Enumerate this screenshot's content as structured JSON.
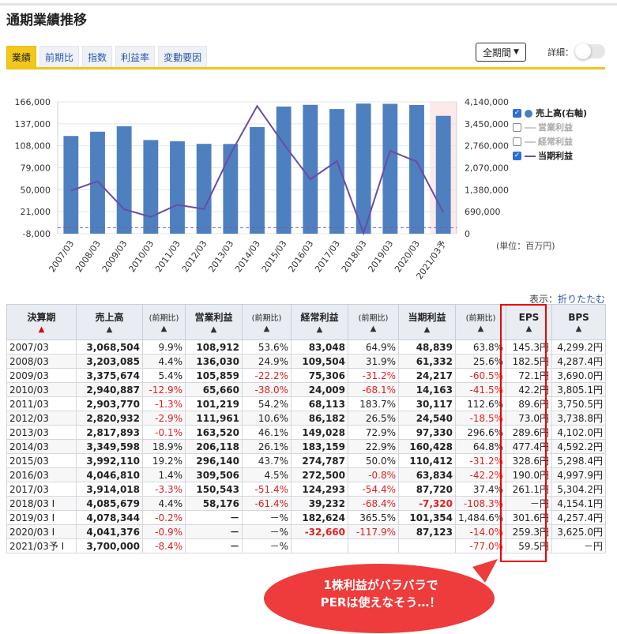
{
  "page": {
    "title": "通期業績推移"
  },
  "tabs": [
    {
      "label": "業績",
      "active": true
    },
    {
      "label": "前期比",
      "active": false
    },
    {
      "label": "指数",
      "active": false
    },
    {
      "label": "利益率",
      "active": false
    },
    {
      "label": "変動要因",
      "active": false
    }
  ],
  "controls": {
    "period": "全期間",
    "detail_label": "詳細："
  },
  "legend": [
    {
      "label": "売上高(右軸)",
      "checked": true,
      "color": "#4e80c0"
    },
    {
      "label": "営業利益",
      "checked": false,
      "color": "#aaaaaa"
    },
    {
      "label": "経常利益",
      "checked": false,
      "color": "#aaaaaa"
    },
    {
      "label": "当期利益",
      "checked": true,
      "color": "#6a4ba6"
    }
  ],
  "chart_data": {
    "type": "bar",
    "categories": [
      "2007/03",
      "2008/03",
      "2009/03",
      "2010/03",
      "2011/03",
      "2012/03",
      "2013/03",
      "2014/03",
      "2015/03",
      "2016/03",
      "2017/03",
      "2018/03",
      "2019/03",
      "2020/03",
      "2021/03予"
    ],
    "series": [
      {
        "name": "売上高(右軸)",
        "type": "bar",
        "axis": "right",
        "color": "#4e80c0",
        "values": [
          3068504,
          3203085,
          3375674,
          2940887,
          2903770,
          2820932,
          2817893,
          3349598,
          3992110,
          4046810,
          3914018,
          4085679,
          4078344,
          4041376,
          3700000
        ]
      },
      {
        "name": "当期利益",
        "type": "line",
        "axis": "left",
        "color": "#6a4ba6",
        "values": [
          48839,
          61332,
          24217,
          14163,
          30117,
          24540,
          97330,
          160428,
          110412,
          63834,
          87720,
          -7320,
          101354,
          87123,
          null
        ]
      }
    ],
    "left_ticks": [
      "166,000",
      "137,000",
      "108,000",
      "79,000",
      "50,000",
      "21,000",
      "-8,000"
    ],
    "right_ticks": [
      "4,140,000",
      "3,450,000",
      "2,760,000",
      "2,070,000",
      "1,380,000",
      "690,000",
      "0"
    ],
    "ylim_left": [
      -8000,
      166000
    ],
    "ylim_right": [
      0,
      4140000
    ],
    "unit": "(単位：百万円)",
    "highlight_category": "2021/03予",
    "highlight_color": "#fde9ea",
    "zero_line_color": "#7a5aa8"
  },
  "fold": {
    "prefix": "表示：",
    "link": "折りたたむ"
  },
  "table": {
    "headers": [
      "決算期",
      "売上高",
      "(前期比)",
      "営業利益",
      "(前期比)",
      "経常利益",
      "(前期比)",
      "当期利益",
      "(前期比)",
      "EPS",
      "BPS"
    ],
    "rows": [
      [
        "2007/03",
        "3,068,504",
        "9.9%",
        "108,912",
        "53.6%",
        "83,048",
        "64.9%",
        "48,839",
        "63.8%",
        "145.3円",
        "4,299.2円"
      ],
      [
        "2008/03",
        "3,203,085",
        "4.4%",
        "136,030",
        "24.9%",
        "109,504",
        "31.9%",
        "61,332",
        "25.6%",
        "182.5円",
        "4,287.4円"
      ],
      [
        "2009/03",
        "3,375,674",
        "5.4%",
        "105,859",
        "-22.2%",
        "75,306",
        "-31.2%",
        "24,217",
        "-60.5%",
        "72.1円",
        "3,690.0円"
      ],
      [
        "2010/03",
        "2,940,887",
        "-12.9%",
        "65,660",
        "-38.0%",
        "24,009",
        "-68.1%",
        "14,163",
        "-41.5%",
        "42.2円",
        "3,805.1円"
      ],
      [
        "2011/03",
        "2,903,770",
        "-1.3%",
        "101,219",
        "54.2%",
        "68,113",
        "183.7%",
        "30,117",
        "112.6%",
        "89.6円",
        "3,750.5円"
      ],
      [
        "2012/03",
        "2,820,932",
        "-2.9%",
        "111,961",
        "10.6%",
        "86,182",
        "26.5%",
        "24,540",
        "-18.5%",
        "73.0円",
        "3,738.8円"
      ],
      [
        "2013/03",
        "2,817,893",
        "-0.1%",
        "163,520",
        "46.1%",
        "149,028",
        "72.9%",
        "97,330",
        "296.6%",
        "289.6円",
        "4,102.0円"
      ],
      [
        "2014/03",
        "3,349,598",
        "18.9%",
        "206,118",
        "26.1%",
        "183,159",
        "22.9%",
        "160,428",
        "64.8%",
        "477.4円",
        "4,592.2円"
      ],
      [
        "2015/03",
        "3,992,110",
        "19.2%",
        "296,140",
        "43.7%",
        "274,787",
        "50.0%",
        "110,412",
        "-31.2%",
        "328.6円",
        "5,298.4円"
      ],
      [
        "2016/03",
        "4,046,810",
        "1.4%",
        "309,506",
        "4.5%",
        "272,500",
        "-0.8%",
        "63,834",
        "-42.2%",
        "190.0円",
        "4,997.9円"
      ],
      [
        "2017/03",
        "3,914,018",
        "-3.3%",
        "150,543",
        "-51.4%",
        "124,293",
        "-54.4%",
        "87,720",
        "37.4%",
        "261.1円",
        "5,304.2円"
      ],
      [
        "2018/03 I",
        "4,085,679",
        "4.4%",
        "58,176",
        "-61.4%",
        "39,232",
        "-68.4%",
        "-7,320",
        "-108.3%",
        "－円",
        "4,154.1円"
      ],
      [
        "2019/03 I",
        "4,078,344",
        "-0.2%",
        "－",
        "－%",
        "182,624",
        "365.5%",
        "101,354",
        "1,484.6%",
        "301.6円",
        "4,257.4円"
      ],
      [
        "2020/03 I",
        "4,041,376",
        "-0.9%",
        "－",
        "－%",
        "-32,660",
        "-117.9%",
        "87,123",
        "-14.0%",
        "259.3円",
        "3,625.0円"
      ],
      [
        "2021/03予 I",
        "3,700,000",
        "-8.4%",
        "－",
        "－%",
        "",
        "",
        "",
        "-77.0%",
        "59.5円",
        "－円"
      ]
    ]
  },
  "callout": {
    "line1": "1株利益がバラバラで",
    "line2": "PERは使えなそう…！",
    "color": "#ee3b3b"
  }
}
